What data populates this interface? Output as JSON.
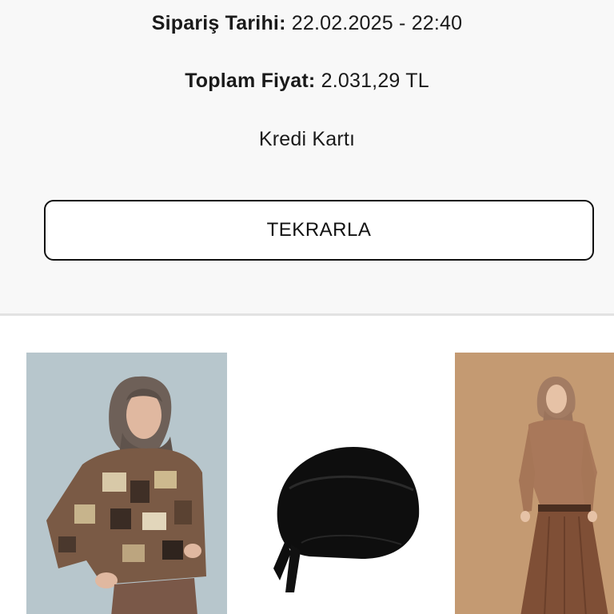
{
  "order": {
    "date_label": "Sipariş Tarihi:",
    "date_value": "22.02.2025 - 22:40",
    "total_label": "Toplam Fiyat:",
    "total_value": "2.031,29 TL",
    "payment_method": "Kredi Kartı"
  },
  "actions": {
    "repeat_label": "TEKRARLA"
  },
  "products": [
    {
      "image": "woman in brown patterned blouse with hijab",
      "background": "#b9c7cd"
    },
    {
      "image": "black bonnet cap",
      "background": "#ffffff"
    },
    {
      "image": "woman in brown shirt and long skirt with hijab",
      "background": "#c49a72"
    }
  ]
}
